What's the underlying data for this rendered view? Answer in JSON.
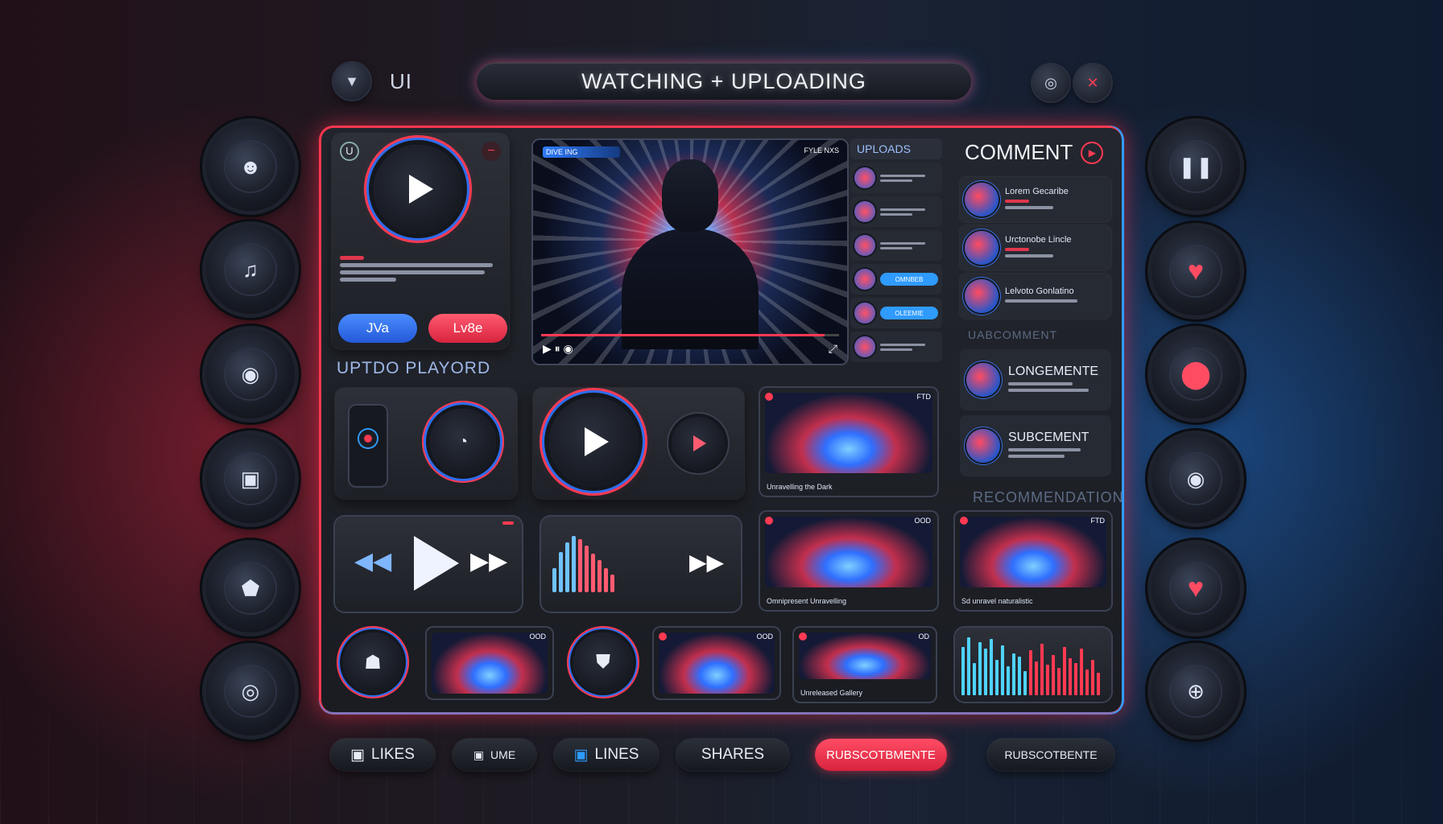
{
  "top": {
    "left_icon": "arrow-down-icon",
    "left_label": "UI",
    "title": "WATCHING + UPLOADING",
    "right_icons": [
      "record-icon",
      "close-icon"
    ]
  },
  "left_knobs": [
    "user-icon",
    "music-icon",
    "camera-icon",
    "gallery-icon",
    "shield-icon",
    "target-icon"
  ],
  "right_knobs": [
    "pause-icon",
    "heart-icon",
    "location-icon",
    "camera-icon",
    "heart-icon",
    "plus-icon"
  ],
  "player_card": {
    "badge": "U",
    "button_blue": "JVa",
    "button_red": "Lv8e"
  },
  "playlist_title": "UPTDO PLAYORD",
  "video": {
    "tag": "DIVE ING",
    "corner": "FYLE NXS",
    "progress": 0.95,
    "controls": "▶  ⏸  ◉"
  },
  "uploads": {
    "title": "UPLOADS",
    "items": [
      {
        "kind": "text"
      },
      {
        "kind": "text"
      },
      {
        "kind": "text"
      },
      {
        "kind": "pill",
        "pill": "OMNBEB"
      },
      {
        "kind": "pill",
        "pill": "OLEEMIE"
      },
      {
        "kind": "text"
      }
    ]
  },
  "comments": {
    "title": "COMMENT",
    "items": [
      {
        "name": "Lorem Gecaribe"
      },
      {
        "name": "Urctonobe Lincle"
      },
      {
        "name": "Lelvoto Gonlatino"
      }
    ],
    "section": "UABCOMMENT",
    "items2": [
      {
        "name": "LONGEMENTE"
      },
      {
        "name": "SUBCEMENT"
      }
    ]
  },
  "recommendation_title": "RECOMMENDATION",
  "thumbs": [
    {
      "cap": "Unravelling the Dark",
      "bdg": "FTD"
    },
    {
      "cap": "Omnipresent Unravelling",
      "bdg": "OOD"
    },
    {
      "cap": "Sd unravel naturalistic",
      "bdg": "FTD"
    },
    {
      "cap": "",
      "bdg": "OOD"
    },
    {
      "cap": "",
      "bdg": "OOD"
    },
    {
      "cap": "Unreleased Gallery",
      "bdg": "OD"
    }
  ],
  "bottom": [
    {
      "label": "LIKES",
      "icon": "chat-icon"
    },
    {
      "label": "UME",
      "icon": "chat-icon"
    },
    {
      "label": "LINES",
      "icon": "chat-icon"
    },
    {
      "label": "SHARES",
      "icon": ""
    },
    {
      "label": "RUBSCOTBMENTE",
      "icon": ""
    },
    {
      "label": "RUBSCOTBENTE",
      "icon": ""
    }
  ],
  "colors": {
    "accent_red": "#ff3a52",
    "accent_blue": "#2f9bff"
  }
}
